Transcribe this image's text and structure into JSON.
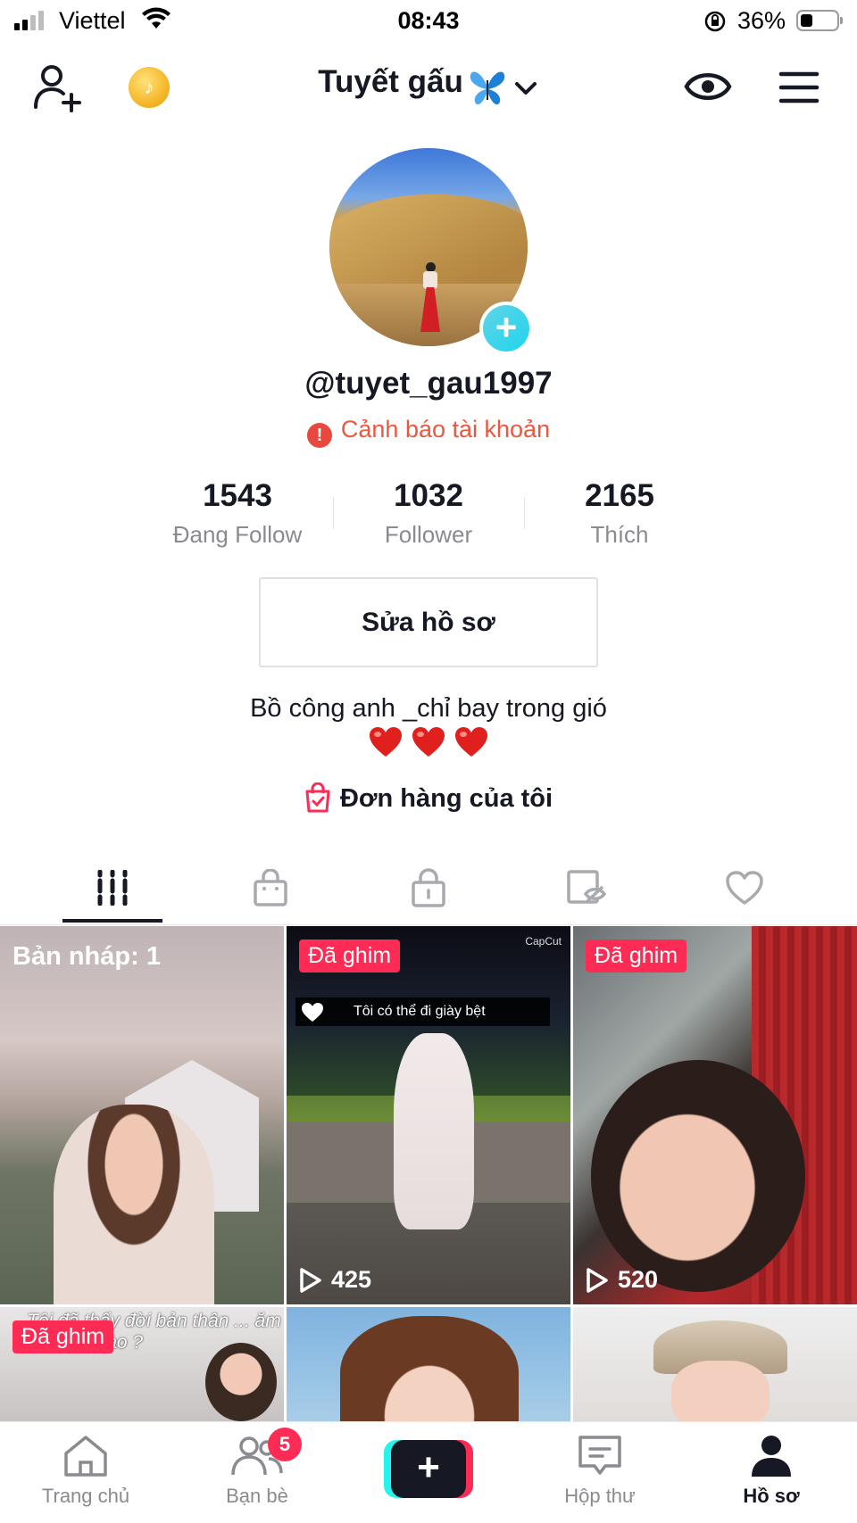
{
  "status_bar": {
    "carrier": "Viettel",
    "time": "08:43",
    "battery": "36%",
    "battery_level": 0.36
  },
  "header": {
    "title": "Tuyết gấu",
    "icons": [
      "add-user-icon",
      "tiktok-coin-icon",
      "butterfly-icon",
      "chevron-down-icon",
      "eye-icon",
      "menu-icon"
    ]
  },
  "profile": {
    "username": "@tuyet_gau1997",
    "warning": "Cảnh báo tài khoản",
    "warning_icon": "!",
    "stats": [
      {
        "value": "1543",
        "label": "Đang Follow"
      },
      {
        "value": "1032",
        "label": "Follower"
      },
      {
        "value": "2165",
        "label": "Thích"
      }
    ],
    "edit_button": "Sửa hồ sơ",
    "bio": "Bồ công anh _chỉ bay trong gió",
    "bio_emoji_count": 3,
    "orders": "Đơn hàng của tôi"
  },
  "tabs": [
    {
      "icon": "grid-icon",
      "active": true
    },
    {
      "icon": "shop-bag-icon",
      "active": false
    },
    {
      "icon": "lock-icon",
      "active": false
    },
    {
      "icon": "hidden-tag-icon",
      "active": false
    },
    {
      "icon": "heart-outline-icon",
      "active": false
    }
  ],
  "videos": [
    {
      "label": "Bản nháp: 1",
      "type": "draft"
    },
    {
      "badge": "Đã ghim",
      "views": "425",
      "caption": "Tôi có thể đi giày bệt",
      "watermark": "CapCut"
    },
    {
      "badge": "Đã ghim",
      "views": "520"
    },
    {
      "badge": "Đã ghim",
      "overlay": "Tôi đã thấy đời bản thân ... ăm như thế nào ?"
    },
    {},
    {}
  ],
  "bottom_nav": [
    {
      "label": "Trang chủ",
      "icon": "home-icon",
      "active": false
    },
    {
      "label": "Bạn bè",
      "icon": "friends-icon",
      "active": false,
      "badge": "5"
    },
    {
      "label": "",
      "icon": "create-plus-icon",
      "active": false
    },
    {
      "label": "Hộp thư",
      "icon": "inbox-icon",
      "active": false
    },
    {
      "label": "Hồ sơ",
      "icon": "profile-icon",
      "active": true
    }
  ],
  "colors": {
    "accent": "#fe2c55",
    "cyan": "#25f4ee",
    "warning": "#e9583f",
    "text": "#161823",
    "muted": "#8a8b91"
  }
}
